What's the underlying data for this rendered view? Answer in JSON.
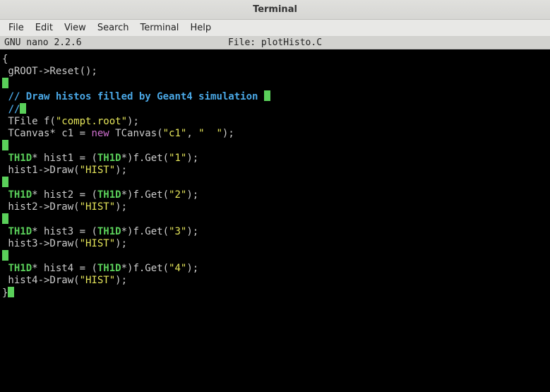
{
  "window": {
    "title": "Terminal"
  },
  "menu": {
    "items": [
      "File",
      "Edit",
      "View",
      "Search",
      "Terminal",
      "Help"
    ]
  },
  "statusbar": {
    "left": "  GNU nano 2.2.6",
    "center": "File: plotHisto.C"
  },
  "code": {
    "lines": [
      {
        "type": "plain",
        "text": "{"
      },
      {
        "type": "plain",
        "text": " gROOT->Reset();"
      },
      {
        "type": "blank_cursor"
      },
      {
        "type": "comment",
        "prefix": " ",
        "text": "// Draw histos filled by Geant4 simulation "
      },
      {
        "type": "comment_cursor",
        "prefix": " ",
        "text": "//"
      },
      {
        "type": "tfile",
        "prefix": " ",
        "a": "TFile f(",
        "str": "\"compt.root\"",
        "b": ");"
      },
      {
        "type": "tcanvas",
        "prefix": " ",
        "a": "TCanvas* c1 = ",
        "new": "new",
        "b": " TCanvas(",
        "s1": "\"c1\"",
        "c": ", ",
        "s2": "\"  \"",
        "d": ");"
      },
      {
        "type": "blank_cursor"
      },
      {
        "type": "hist_decl",
        "prefix": " ",
        "name": "hist1",
        "num": "\"1\""
      },
      {
        "type": "hist_draw",
        "prefix": " ",
        "name": "hist1"
      },
      {
        "type": "blank_cursor"
      },
      {
        "type": "hist_decl",
        "prefix": " ",
        "name": "hist2",
        "num": "\"2\""
      },
      {
        "type": "hist_draw",
        "prefix": " ",
        "name": "hist2"
      },
      {
        "type": "blank_cursor"
      },
      {
        "type": "hist_decl",
        "prefix": " ",
        "name": "hist3",
        "num": "\"3\""
      },
      {
        "type": "hist_draw",
        "prefix": " ",
        "name": "hist3"
      },
      {
        "type": "blank_cursor"
      },
      {
        "type": "hist_decl",
        "prefix": " ",
        "name": "hist4",
        "num": "\"4\""
      },
      {
        "type": "hist_draw",
        "prefix": " ",
        "name": "hist4"
      },
      {
        "type": "close_brace"
      }
    ],
    "tokens": {
      "TH1D": "TH1D",
      "HIST": "\"HIST\"",
      "get": "*)f.Get(",
      "afterGet": ");",
      "draw": "->Draw(",
      "afterDraw": ");",
      "star_hist": "* ",
      "eq_paren": " = ("
    }
  }
}
